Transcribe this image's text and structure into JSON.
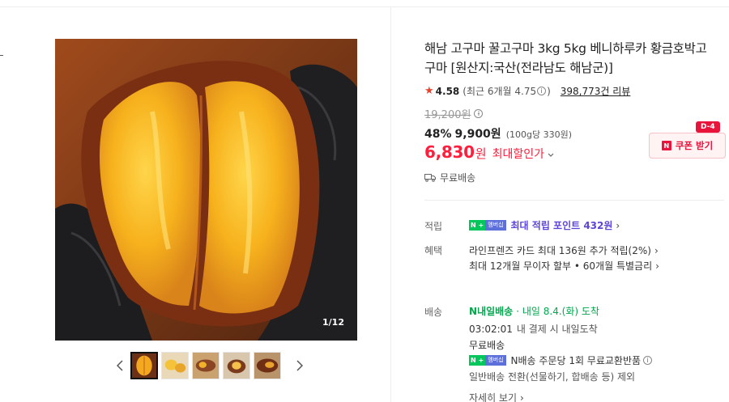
{
  "gallery": {
    "counter": "1/12",
    "prev_arrow": "‹",
    "next_arrow": "›",
    "thumbnail_count": 5
  },
  "product": {
    "title": "해남 고구마 꿀고구마 3kg 5kg 베니하루카 황금호박고구마 [원산지:국산(전라남도 해남군)]",
    "rating": "4.58",
    "rating_recent_prefix": "(최근 6개월 4.75",
    "rating_recent_suffix": ")",
    "reviews": "398,773건 리뷰",
    "original_price": "19,200원",
    "discount_rate": "48%",
    "sale_price": "9,900원",
    "unit_price": "(100g당 330원)",
    "final_price": "6,830",
    "final_won": "원",
    "max_discount_label": "최대할인가",
    "shipping_fee": "무료배송"
  },
  "coupon": {
    "badge": "D-4",
    "n_icon": "N",
    "label": "쿠폰 받기"
  },
  "benefits": {
    "points_label": "적립",
    "points_badge_n": "N +",
    "points_badge_member": "멤버십",
    "points_text": "최대 적립 포인트 432원",
    "benefit_label": "혜택",
    "card_text": "라인프렌즈 카드 최대 136원 추가 적립(2%)",
    "installment_text": "최대 12개월 무이자 할부 • 60개월 특별금리"
  },
  "delivery": {
    "label": "배송",
    "tomorrow_badge": "N내일배송",
    "arrival_text": "· 내일 8.4.(화) 도착",
    "deadline_time": "03:02:01",
    "deadline_text": "내 결제 시 내일도착",
    "fee": "무료배송",
    "return_badge_n": "N +",
    "return_badge_member": "멤버십",
    "return_text": "N배송 주문당 1회 무료교환반품",
    "exclude_text": "일반배송 전환(선물하기, 합배송 등) 제외",
    "detail_link": "자세히 보기"
  },
  "colors": {
    "accent_red": "#ff1e3c",
    "naver_green": "#03c75a",
    "point_purple": "#5d45d8"
  }
}
